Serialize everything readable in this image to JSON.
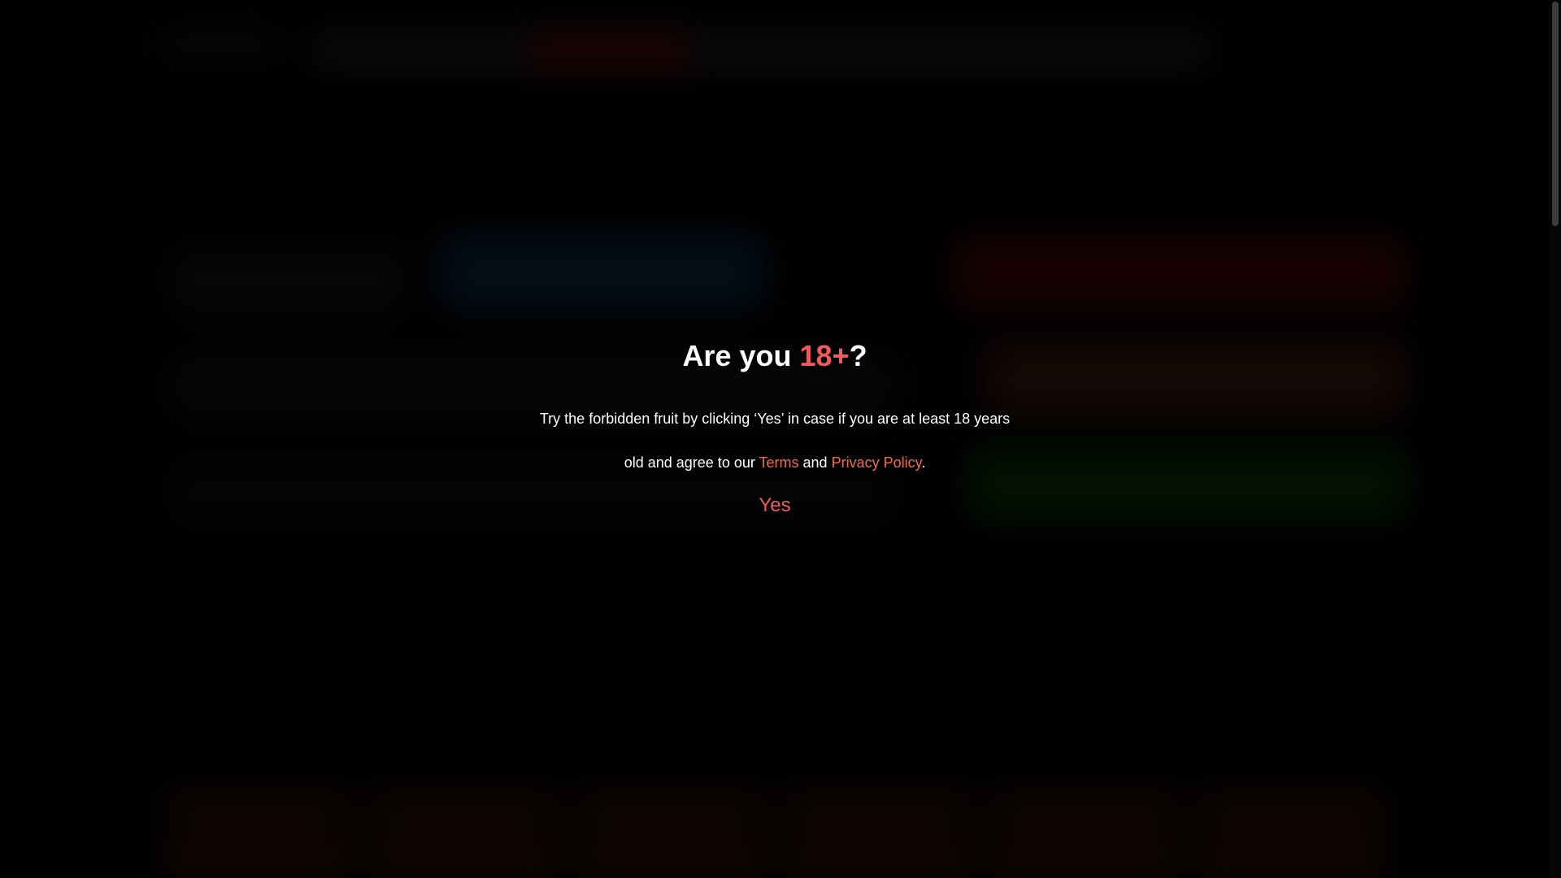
{
  "modal": {
    "title_prefix": "Are you ",
    "title_accent": "18+",
    "title_suffix": "?",
    "text_part1": "Try the forbidden fruit by clicking ‘Yes’ in case if you are at least 18 years old and agree to our ",
    "terms_link": "Terms",
    "text_and": " and ",
    "privacy_link": "Privacy Policy",
    "text_end": ".",
    "yes_button": "Yes"
  },
  "colors": {
    "background": "#000000",
    "accent": "#ef5b5b",
    "link": "#ef6c4f",
    "text": "#ffffff"
  }
}
